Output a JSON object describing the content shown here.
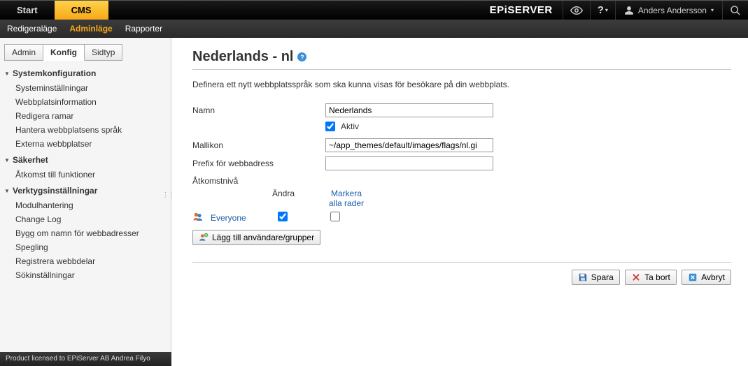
{
  "topbar": {
    "tabs": [
      {
        "label": "Start",
        "active": false
      },
      {
        "label": "CMS",
        "active": true
      }
    ],
    "brand": "EPiSERVER",
    "user": "Anders Andersson"
  },
  "secbar": {
    "items": [
      {
        "label": "Redigeraläge",
        "active": false
      },
      {
        "label": "Adminläge",
        "active": true
      },
      {
        "label": "Rapporter",
        "active": false
      }
    ]
  },
  "sidebar": {
    "tabs": [
      {
        "label": "Admin",
        "active": false
      },
      {
        "label": "Konfig",
        "active": true
      },
      {
        "label": "Sidtyp",
        "active": false
      }
    ],
    "groups": [
      {
        "label": "Systemkonfiguration",
        "items": [
          "Systeminställningar",
          "Webbplatsinformation",
          "Redigera ramar",
          "Hantera webbplatsens språk",
          "Externa webbplatser"
        ]
      },
      {
        "label": "Säkerhet",
        "items": [
          "Åtkomst till funktioner"
        ]
      },
      {
        "label": "Verktygsinställningar",
        "items": [
          "Modulhantering",
          "Change Log",
          "Bygg om namn för webbadresser",
          "Spegling",
          "Registrera webbdelar",
          "Sökinställningar"
        ]
      }
    ]
  },
  "main": {
    "title": "Nederlands - nl",
    "desc": "Definera ett nytt webbplatsspråk som ska kunna visas för besökare på din webbplats.",
    "fields": {
      "name_label": "Namn",
      "name_value": "Nederlands",
      "active_label": "Aktiv",
      "active_checked": true,
      "icon_label": "Mallikon",
      "icon_value": "~/app_themes/default/images/flags/nl.gi",
      "prefix_label": "Prefix för webbadress",
      "prefix_value": ""
    },
    "access": {
      "label": "Åtkomstnivå",
      "col_change": "Ändra",
      "col_markall": "Markera alla rader",
      "rows": [
        {
          "name": "Everyone",
          "change_checked": true,
          "mark_checked": false
        }
      ],
      "add_button": "Lägg till användare/grupper"
    },
    "actions": {
      "save": "Spara",
      "delete": "Ta bort",
      "cancel": "Avbryt"
    }
  },
  "footer": "Product licensed to EPiServer AB Andrea Filyo"
}
